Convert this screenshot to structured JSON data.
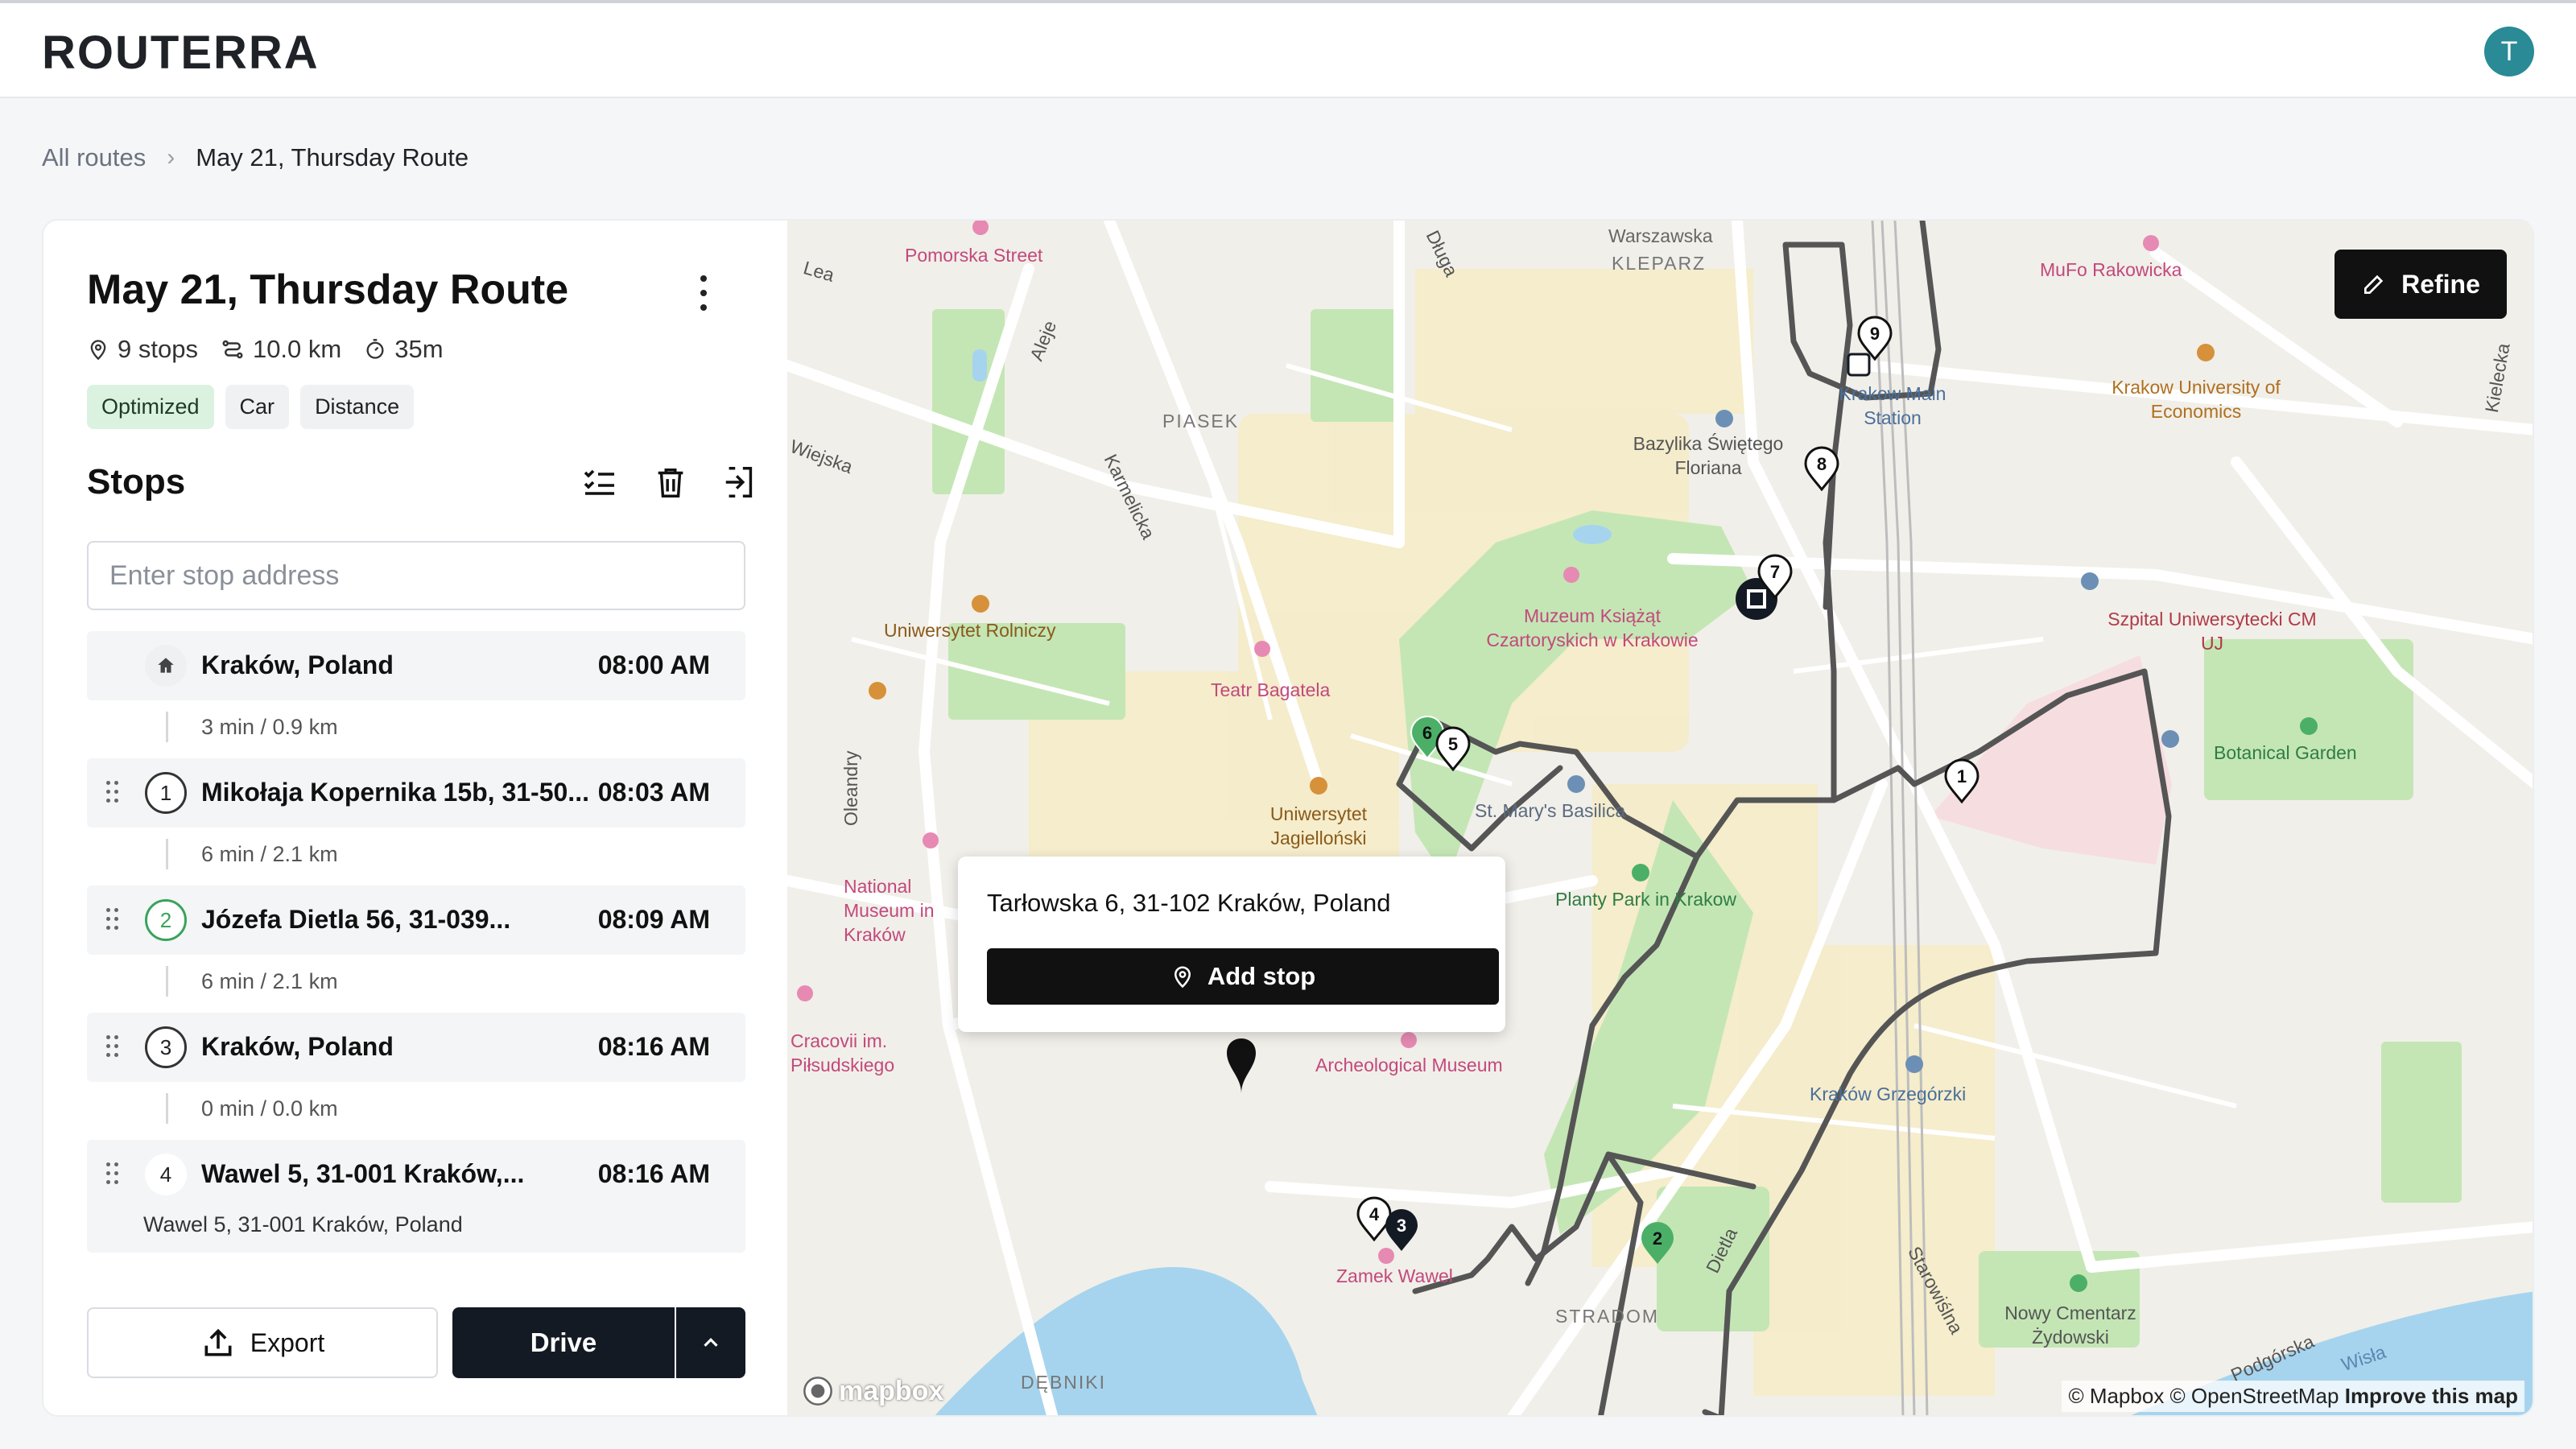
{
  "app": {
    "logo": "ROUTERRA",
    "avatar_initial": "T"
  },
  "breadcrumb": {
    "root": "All routes",
    "current": "May 21, Thursday Route"
  },
  "route": {
    "title": "May 21, Thursday Route",
    "stops_count": "9 stops",
    "distance": "10.0 km",
    "duration": "35m",
    "tags": [
      "Optimized",
      "Car",
      "Distance"
    ]
  },
  "stops_section": {
    "title": "Stops",
    "address_placeholder": "Enter stop address"
  },
  "stops": [
    {
      "label": "",
      "name": "Kraków, Poland",
      "time": "08:00 AM",
      "leg": "3 min / 0.9 km"
    },
    {
      "label": "1",
      "name": "Mikołaja Kopernika 15b, 31-50...",
      "time": "08:03 AM",
      "leg": "6 min / 2.1 km"
    },
    {
      "label": "2",
      "name": "Józefa Dietla 56, 31-039...",
      "time": "08:09 AM",
      "leg": "6 min / 2.1 km"
    },
    {
      "label": "3",
      "name": "Kraków, Poland",
      "time": "08:16 AM",
      "leg": "0 min / 0.0 km"
    },
    {
      "label": "4",
      "name": "Wawel 5, 31-001 Kraków,...",
      "time": "08:16 AM",
      "sub": "Wawel 5, 31-001 Kraków, Poland"
    }
  ],
  "footer": {
    "export_label": "Export",
    "drive_label": "Drive"
  },
  "map": {
    "refine_label": "Refine",
    "popup": {
      "address": "Tarłowska 6, 31-102 Kraków, Poland",
      "button": "Add stop"
    },
    "attribution": {
      "text": "© Mapbox © OpenStreetMap",
      "link": "Improve this map"
    },
    "logo": "mapbox",
    "labels": [
      "Warszawska",
      "KLEPARZ",
      "Pomorska Street",
      "MuFo Rakowicka",
      "PIASEK",
      "Krakow Main Station",
      "Krakow University of Economics",
      "Bazylika Świętego Floriana",
      "Uniwersytet Rolniczy",
      "Muzeum Książąt Czartoryskich w Krakowie",
      "Teatr Bagatela",
      "Szpital Uniwersytecki CM UJ",
      "Botanical Garden",
      "St. Mary's Basilica",
      "Uniwersytet Jagielloński",
      "National Museum in Kraków",
      "Planty Park in Krakow",
      "Cracovii im. Piłsudskiego",
      "Archeological Museum",
      "Kraków Grzegórzki",
      "Zamek Wawel",
      "STRADOM",
      "Nowy Cmentarz Żydowski",
      "DĘBNIKI",
      "Starowiślna",
      "Podgórska",
      "Wisła",
      "Karmelicka",
      "Długa",
      "Aleje",
      "Kielecka",
      "Dietla",
      "Oleandry",
      "Lea",
      "Wiejska"
    ],
    "markers": [
      "1",
      "2",
      "3",
      "4",
      "5",
      "6",
      "7",
      "8",
      "9"
    ]
  },
  "colors": {
    "accent": "#141a24",
    "green": "#3aa35b",
    "route": "#555555",
    "water": "#a6d4ee",
    "park": "#c4e6b5"
  }
}
